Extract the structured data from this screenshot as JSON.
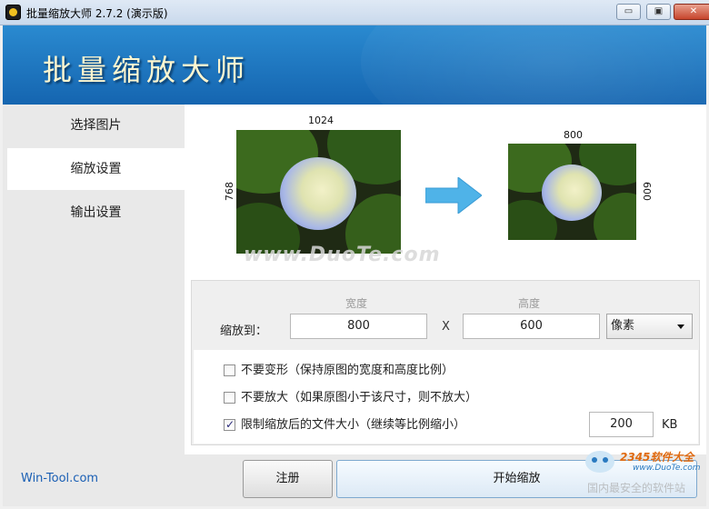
{
  "window": {
    "title": "批量缩放大师 2.7.2 (演示版)",
    "minimize_icon": "minimize-icon",
    "maximize_icon": "restore-icon",
    "close_icon": "close-icon"
  },
  "banner": {
    "heading": "批量缩放大师"
  },
  "sidebar": {
    "items": [
      {
        "label": "选择图片",
        "active": false
      },
      {
        "label": "缩放设置",
        "active": true
      },
      {
        "label": "输出设置",
        "active": false
      }
    ]
  },
  "preview": {
    "original": {
      "width_label": "1024",
      "height_label": "768"
    },
    "resized": {
      "width_label": "800",
      "height_label": "600"
    },
    "watermark": "www.DuoTe.com",
    "arrow_icon": "arrow-right-icon"
  },
  "scale": {
    "label": "缩放到：",
    "width_header": "宽度",
    "height_header": "高度",
    "width_value": "800",
    "height_value": "600",
    "separator": "X",
    "unit": "像素"
  },
  "options": [
    {
      "label": "不要变形（保持原图的宽度和高度比例）",
      "checked": false
    },
    {
      "label": "不要放大（如果原图小于该尺寸，则不放大）",
      "checked": false
    },
    {
      "label": "限制缩放后的文件大小（继续等比例缩小）",
      "checked": true
    }
  ],
  "filesize": {
    "value": "200",
    "unit": "KB"
  },
  "footer": {
    "site": "Win-Tool.com",
    "register_label": "注册",
    "start_label": "开始缩放"
  },
  "corner_watermark": {
    "brand": "2345软件大全",
    "url": "www.DuoTe.com",
    "slogan": "国内最安全的软件站"
  },
  "colors": {
    "banner": "#1a74c0",
    "banner_text": "#fdf6d0",
    "link": "#1a5fb4",
    "arrow": "#4fb3e8"
  }
}
